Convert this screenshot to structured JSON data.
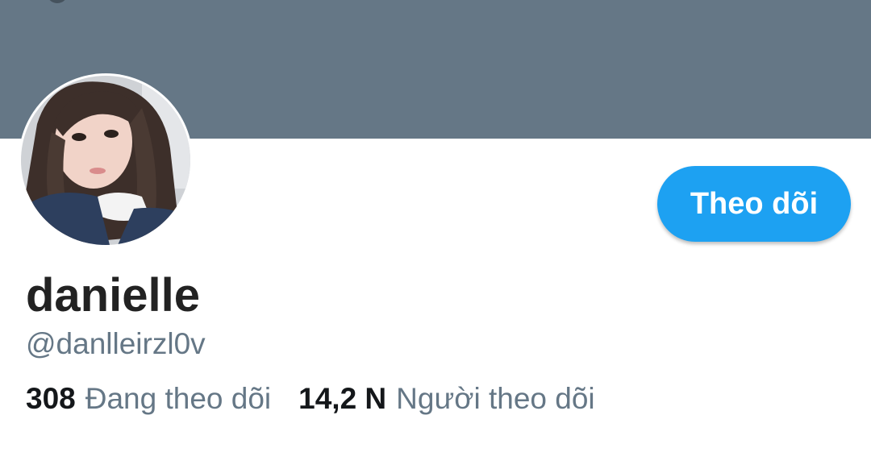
{
  "profile": {
    "display_name": "danielle",
    "handle": "@danlleirzl0v",
    "follow_label": "Theo dõi"
  },
  "stats": {
    "following_count": "308",
    "following_label": "Đang theo dõi",
    "followers_count": "14,2 N",
    "followers_label": "Người theo dõi"
  },
  "colors": {
    "banner": "#657786",
    "accent": "#1da1f2",
    "secondary_text": "#657786",
    "primary_text": "#14171a"
  }
}
